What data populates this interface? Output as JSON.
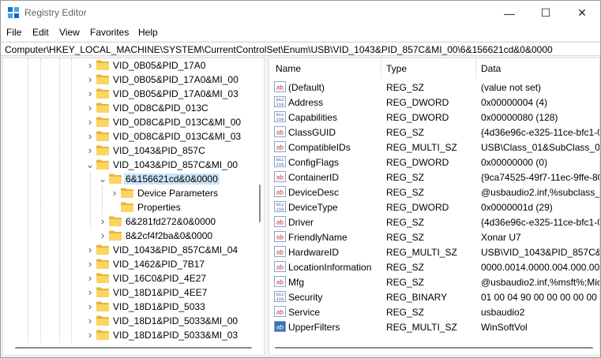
{
  "window": {
    "title": "Registry Editor",
    "minimize": "—",
    "maximize": "☐",
    "close": "✕"
  },
  "menu": [
    "File",
    "Edit",
    "View",
    "Favorites",
    "Help"
  ],
  "address": "Computer\\HKEY_LOCAL_MACHINE\\SYSTEM\\CurrentControlSet\\Enum\\USB\\VID_1043&PID_857C&MI_00\\6&156621cd&0&0000",
  "tree": [
    {
      "label": "VID_0B05&PID_17A0",
      "expanded": false
    },
    {
      "label": "VID_0B05&PID_17A0&MI_00",
      "expanded": false
    },
    {
      "label": "VID_0B05&PID_17A0&MI_03",
      "expanded": false
    },
    {
      "label": "VID_0D8C&PID_013C",
      "expanded": false
    },
    {
      "label": "VID_0D8C&PID_013C&MI_00",
      "expanded": false
    },
    {
      "label": "VID_0D8C&PID_013C&MI_03",
      "expanded": false
    },
    {
      "label": "VID_1043&PID_857C",
      "expanded": false
    },
    {
      "label": "VID_1043&PID_857C&MI_00",
      "expanded": true
    },
    {
      "label": "6&156621cd&0&0000",
      "expanded": true,
      "selected": true
    },
    {
      "label": "Device Parameters",
      "expanded": false
    },
    {
      "label": "Properties",
      "expanded": null
    },
    {
      "label": "6&281fd272&0&0000",
      "expanded": false
    },
    {
      "label": "8&2cf4f2ba&0&0000",
      "expanded": false
    },
    {
      "label": "VID_1043&PID_857C&MI_04",
      "expanded": false
    },
    {
      "label": "VID_1462&PID_7B17",
      "expanded": false
    },
    {
      "label": "VID_16C0&PID_4E27",
      "expanded": false
    },
    {
      "label": "VID_18D1&PID_4EE7",
      "expanded": false
    },
    {
      "label": "VID_18D1&PID_5033",
      "expanded": false
    },
    {
      "label": "VID_18D1&PID_5033&MI_00",
      "expanded": false
    },
    {
      "label": "VID_18D1&PID_5033&MI_03",
      "expanded": false
    }
  ],
  "columns": {
    "name": "Name",
    "type": "Type",
    "data": "Data"
  },
  "values": [
    {
      "icon": "string-value-icon",
      "name": "(Default)",
      "type": "REG_SZ",
      "data": "(value not set)"
    },
    {
      "icon": "binary-value-icon",
      "name": "Address",
      "type": "REG_DWORD",
      "data": "0x00000004 (4)"
    },
    {
      "icon": "binary-value-icon",
      "name": "Capabilities",
      "type": "REG_DWORD",
      "data": "0x00000080 (128)"
    },
    {
      "icon": "string-value-icon",
      "name": "ClassGUID",
      "type": "REG_SZ",
      "data": "{4d36e96c-e325-11ce-bfc1-0"
    },
    {
      "icon": "string-value-icon",
      "name": "CompatibleIDs",
      "type": "REG_MULTI_SZ",
      "data": "USB\\Class_01&SubClass_008"
    },
    {
      "icon": "binary-value-icon",
      "name": "ConfigFlags",
      "type": "REG_DWORD",
      "data": "0x00000000 (0)"
    },
    {
      "icon": "string-value-icon",
      "name": "ContainerID",
      "type": "REG_SZ",
      "data": "{9ca74525-49f7-11ec-9ffe-80"
    },
    {
      "icon": "string-value-icon",
      "name": "DeviceDesc",
      "type": "REG_SZ",
      "data": "@usbaudio2.inf,%subclass_0"
    },
    {
      "icon": "binary-value-icon",
      "name": "DeviceType",
      "type": "REG_DWORD",
      "data": "0x0000001d (29)"
    },
    {
      "icon": "string-value-icon",
      "name": "Driver",
      "type": "REG_SZ",
      "data": "{4d36e96c-e325-11ce-bfc1-0"
    },
    {
      "icon": "string-value-icon",
      "name": "FriendlyName",
      "type": "REG_SZ",
      "data": "Xonar U7"
    },
    {
      "icon": "string-value-icon",
      "name": "HardwareID",
      "type": "REG_MULTI_SZ",
      "data": "USB\\VID_1043&PID_857C&R"
    },
    {
      "icon": "string-value-icon",
      "name": "LocationInformation",
      "type": "REG_SZ",
      "data": "0000.0014.0000.004.000.000.0"
    },
    {
      "icon": "string-value-icon",
      "name": "Mfg",
      "type": "REG_SZ",
      "data": "@usbaudio2.inf,%msft%;Mic"
    },
    {
      "icon": "binary-value-icon",
      "name": "Security",
      "type": "REG_BINARY",
      "data": "01 00 04 90 00 00 00 00 00 00"
    },
    {
      "icon": "string-value-icon",
      "name": "Service",
      "type": "REG_SZ",
      "data": "usbaudio2"
    },
    {
      "icon": "string-value-icon",
      "name": "UpperFilters",
      "type": "REG_MULTI_SZ",
      "data": "WinSoftVol",
      "selected_icon": true
    }
  ],
  "icon_text": {
    "string": "ab",
    "binary": "011 110"
  }
}
